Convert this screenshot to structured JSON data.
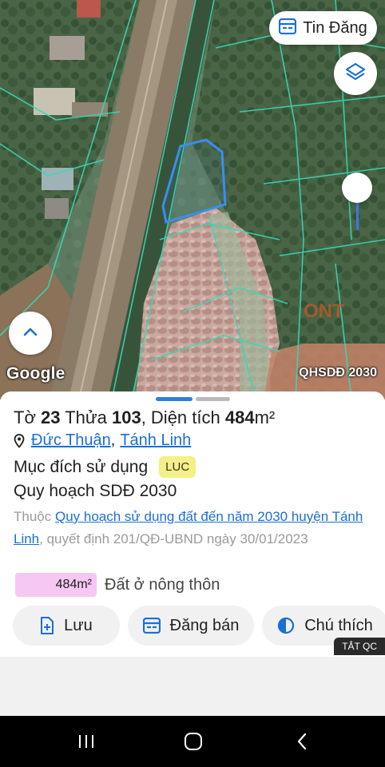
{
  "map": {
    "publish_button_label": "Tin Đăng",
    "provider_label": "Google",
    "layer_tag": "QHSDĐ 2030",
    "zone_code_label": "ONT"
  },
  "parcel": {
    "title_prefix": "Tờ",
    "sheet_number": "23",
    "parcel_prefix": "Thửa",
    "parcel_number": "103",
    "area_prefix": ", Diện tích",
    "area_value": "484",
    "area_unit": "m²",
    "location_commune": "Đức Thuận",
    "location_district": "Tánh Linh",
    "purpose_label": "Mục đích sử dụng",
    "purpose_code": "LUC",
    "plan_title": "Quy hoạch SDĐ 2030",
    "desc_prefix": "Thuộc",
    "desc_link": "Quy hoạch sử dụng đất đến năm 2030 huyện Tánh Linh",
    "desc_suffix": ", quyết định 201/QĐ-UBND ngày 30/01/2023",
    "area_chip_value": "484m²",
    "area_type": "Đất ở nông thôn"
  },
  "actions": {
    "save_label": "Lưu",
    "sell_label": "Đăng bán",
    "note_label": "Chú thích",
    "ad_off_label": "TẮT QC"
  },
  "colors": {
    "accent_blue": "#1a6fd6",
    "luc_badge": "#f4ef86",
    "area_chip": "#f6c7f3"
  }
}
